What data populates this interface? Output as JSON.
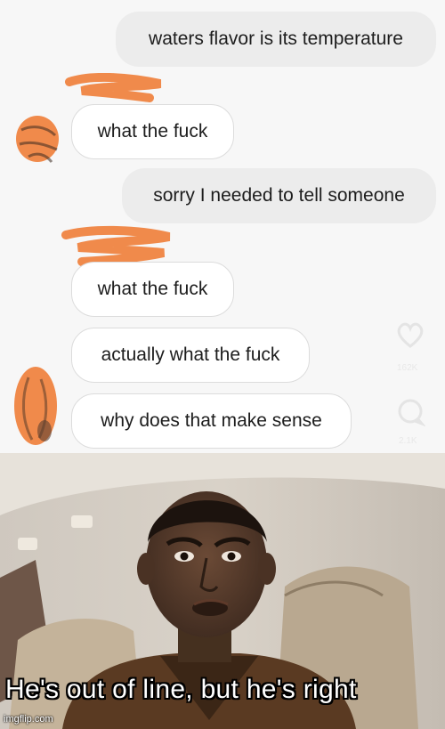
{
  "chat": {
    "messages": [
      {
        "side": "outgoing",
        "text": "waters flavor is its temperature"
      },
      {
        "side": "incoming",
        "text": "what the fuck"
      },
      {
        "side": "outgoing",
        "text": "sorry I needed to tell someone"
      },
      {
        "side": "incoming",
        "text": "what the fuck"
      },
      {
        "side": "incoming",
        "text": "actually what the fuck"
      },
      {
        "side": "incoming",
        "text": "why does that make sense"
      }
    ],
    "side_icons": [
      {
        "icon": "heart-icon",
        "count": "162K"
      },
      {
        "icon": "comment-icon",
        "count": "2.1K"
      }
    ],
    "censor_color": "#f08a4b"
  },
  "meme": {
    "caption": "He's out of line, but he's right",
    "watermark": "imgflip.com"
  }
}
